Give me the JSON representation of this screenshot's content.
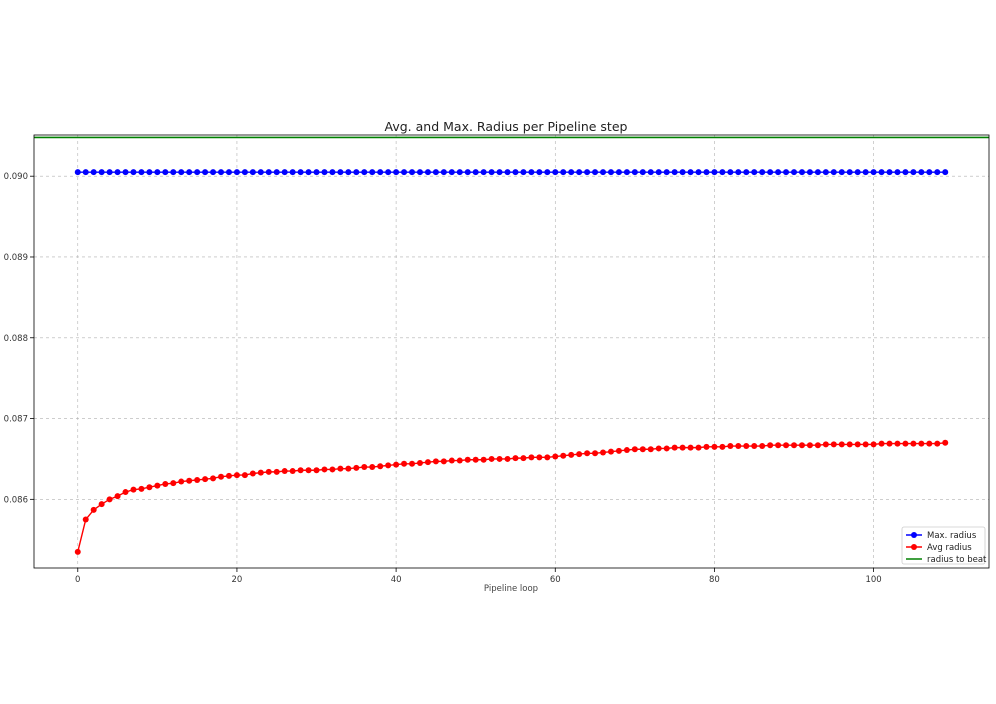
{
  "chart_data": {
    "type": "line",
    "title": "Avg. and Max. Radius per Pipeline step",
    "xlabel": "Pipeline loop",
    "ylabel": "",
    "xlim": [
      -5.5,
      114.5
    ],
    "ylim": [
      0.08515,
      0.09051
    ],
    "x_ticks": [
      0,
      20,
      40,
      60,
      80,
      100
    ],
    "y_ticks": [
      0.086,
      0.087,
      0.088,
      0.089,
      0.09
    ],
    "grid": true,
    "legend_position": "lower-right",
    "series": [
      {
        "name": "Max. radius",
        "color": "#0000ff",
        "marker": "circle",
        "x_start": 0,
        "x_step": 1,
        "values": [
          0.09005,
          0.09005,
          0.09005,
          0.09005,
          0.09005,
          0.09005,
          0.09005,
          0.09005,
          0.09005,
          0.09005,
          0.09005,
          0.09005,
          0.09005,
          0.09005,
          0.09005,
          0.09005,
          0.09005,
          0.09005,
          0.09005,
          0.09005,
          0.09005,
          0.09005,
          0.09005,
          0.09005,
          0.09005,
          0.09005,
          0.09005,
          0.09005,
          0.09005,
          0.09005,
          0.09005,
          0.09005,
          0.09005,
          0.09005,
          0.09005,
          0.09005,
          0.09005,
          0.09005,
          0.09005,
          0.09005,
          0.09005,
          0.09005,
          0.09005,
          0.09005,
          0.09005,
          0.09005,
          0.09005,
          0.09005,
          0.09005,
          0.09005,
          0.09005,
          0.09005,
          0.09005,
          0.09005,
          0.09005,
          0.09005,
          0.09005,
          0.09005,
          0.09005,
          0.09005,
          0.09005,
          0.09005,
          0.09005,
          0.09005,
          0.09005,
          0.09005,
          0.09005,
          0.09005,
          0.09005,
          0.09005,
          0.09005,
          0.09005,
          0.09005,
          0.09005,
          0.09005,
          0.09005,
          0.09005,
          0.09005,
          0.09005,
          0.09005,
          0.09005,
          0.09005,
          0.09005,
          0.09005,
          0.09005,
          0.09005,
          0.09005,
          0.09005,
          0.09005,
          0.09005,
          0.09005,
          0.09005,
          0.09005,
          0.09005,
          0.09005,
          0.09005,
          0.09005,
          0.09005,
          0.09005,
          0.09005,
          0.09005,
          0.09005,
          0.09005,
          0.09005,
          0.09005,
          0.09005,
          0.09005,
          0.09005,
          0.09005,
          0.09005
        ]
      },
      {
        "name": "Avg radius",
        "color": "#ff0000",
        "marker": "circle",
        "x_start": 0,
        "x_step": 1,
        "values": [
          0.08535,
          0.08575,
          0.08587,
          0.08594,
          0.086,
          0.08604,
          0.08609,
          0.08612,
          0.08613,
          0.08615,
          0.08617,
          0.08619,
          0.0862,
          0.08622,
          0.08623,
          0.08624,
          0.08625,
          0.08626,
          0.08628,
          0.08629,
          0.0863,
          0.0863,
          0.08632,
          0.08633,
          0.08634,
          0.08634,
          0.08635,
          0.08635,
          0.08636,
          0.08636,
          0.08636,
          0.08637,
          0.08637,
          0.08638,
          0.08638,
          0.08639,
          0.0864,
          0.0864,
          0.08641,
          0.08642,
          0.08643,
          0.08644,
          0.08644,
          0.08645,
          0.08646,
          0.08647,
          0.08647,
          0.08648,
          0.08648,
          0.08649,
          0.08649,
          0.08649,
          0.0865,
          0.0865,
          0.0865,
          0.08651,
          0.08651,
          0.08652,
          0.08652,
          0.08652,
          0.08653,
          0.08654,
          0.08655,
          0.08656,
          0.08657,
          0.08657,
          0.08658,
          0.08659,
          0.0866,
          0.08661,
          0.08662,
          0.08662,
          0.08662,
          0.08663,
          0.08663,
          0.08664,
          0.08664,
          0.08664,
          0.08664,
          0.08665,
          0.08665,
          0.08665,
          0.08666,
          0.08666,
          0.08666,
          0.08666,
          0.08666,
          0.08667,
          0.08667,
          0.08667,
          0.08667,
          0.08667,
          0.08667,
          0.08667,
          0.08668,
          0.08668,
          0.08668,
          0.08668,
          0.08668,
          0.08668,
          0.08668,
          0.08669,
          0.08669,
          0.08669,
          0.08669,
          0.08669,
          0.08669,
          0.08669,
          0.08669,
          0.0867
        ]
      }
    ],
    "hlines": [
      {
        "name": "radius to beat",
        "color": "#008000",
        "y": 0.09048
      }
    ]
  }
}
